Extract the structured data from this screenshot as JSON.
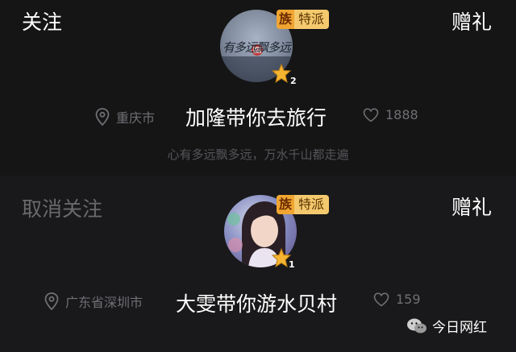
{
  "cards": [
    {
      "follow_label": "关注",
      "gift_label": "赠礼",
      "badge_clan": "族",
      "badge_tag": "特派",
      "rank": "2",
      "location": "重庆市",
      "title": "加隆带你去旅行",
      "likes": "1888",
      "motto": "心有多远飘多远，万水千山都走遍",
      "avatar_text": "有多远飘多远"
    },
    {
      "follow_label": "取消关注",
      "gift_label": "赠礼",
      "badge_clan": "族",
      "badge_tag": "特派",
      "rank": "1",
      "location": "广东省深圳市",
      "title": "大雯带你游水贝村",
      "likes": "159"
    }
  ],
  "watermark": {
    "text": "今日网红",
    "icon": "wechat-icon"
  },
  "colors": {
    "badge_bg": "#f4c96e",
    "badge_clan_bg": "#f0a531",
    "star": "#f5b431",
    "muted_text": "#6f6f74"
  },
  "icons": {
    "location": "location-pin-icon",
    "likes": "heart-icon",
    "level": "star-icon"
  }
}
